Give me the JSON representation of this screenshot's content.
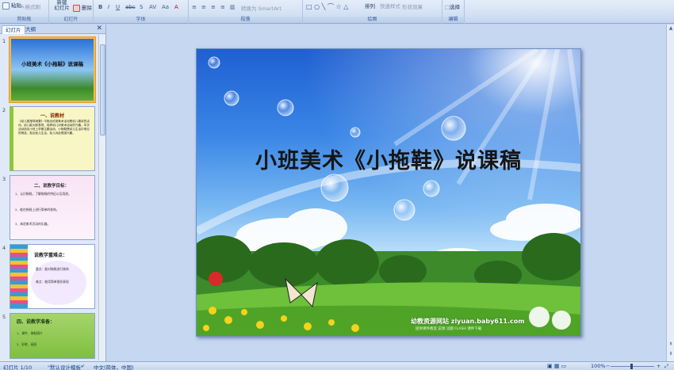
{
  "ribbon": {
    "clipboard": {
      "paste": "粘贴",
      "format_painter": "格式刷",
      "label": "剪贴板"
    },
    "slides": {
      "new_slide": "新建\n幻灯片",
      "delete": "删除",
      "label": "幻灯片"
    },
    "font": {
      "label": "字体"
    },
    "paragraph": {
      "convert_smartart": "转换为 SmartArt",
      "label": "段落"
    },
    "drawing": {
      "arrange": "排列",
      "quick_styles": "快速样式",
      "shape_effects": "形状效果",
      "label": "绘图"
    },
    "editing": {
      "select": "选择",
      "label": "编辑"
    }
  },
  "panel": {
    "tabs": [
      "幻灯片",
      "大纲"
    ],
    "close": "✕",
    "slides": [
      {
        "num": "1",
        "title": "小班美术《小拖鞋》说课稿"
      },
      {
        "num": "2",
        "title": "一、说教材",
        "body": "《幼儿园指导纲要》中指出欣赏美术活动是幼儿喜欢的活动，幼儿能大胆表现，培养幼儿对美术活动的兴趣。本次活动选自小班上学期主题活动，小拖鞋是幼儿生活中常见的物品，贴近幼儿生活，幼儿对此很感兴趣。"
      },
      {
        "num": "3",
        "title": "二、说教学目标：",
        "items": [
          "1、认识拖鞋，了解拖鞋的特征以及用途。",
          "2、能在拖鞋上进行简单的装饰。",
          "3、体验美术活动的乐趣。"
        ]
      },
      {
        "num": "4",
        "title": "说教学重难点：",
        "items": [
          "重点：能对拖鞋进行装饰",
          "难点：能用简单图形表现"
        ]
      },
      {
        "num": "5",
        "title": "四、说教学准备：",
        "items": [
          "1、课件、拖鞋图片",
          "2、彩笔、画纸"
        ]
      }
    ]
  },
  "slide": {
    "title": "小班美术《小拖鞋》说课稿",
    "watermark": "幼教资源网站 ziyuan.baby611.com",
    "watermark_sub": "提供课件教案 说课 试题 FLASH 课件下载"
  },
  "status": {
    "slide_pos": "幻灯片 1/10",
    "theme": "\"默认设计模板\"",
    "language": "中文(简体，中国)",
    "zoom": "100%"
  },
  "colors": {
    "ribbon_bg": "#dbe6f6",
    "selected_thumb": "#f5b94b",
    "slide_title": "#151515"
  },
  "icons": [
    "paste-icon",
    "scissors-icon",
    "copy-icon",
    "format-painter-icon",
    "new-slide-icon",
    "delete-icon",
    "bold-icon",
    "italic-icon",
    "underline-icon",
    "shapes-icon",
    "select-icon",
    "fit-slide-icon",
    "zoom-out-icon",
    "zoom-in-icon"
  ]
}
